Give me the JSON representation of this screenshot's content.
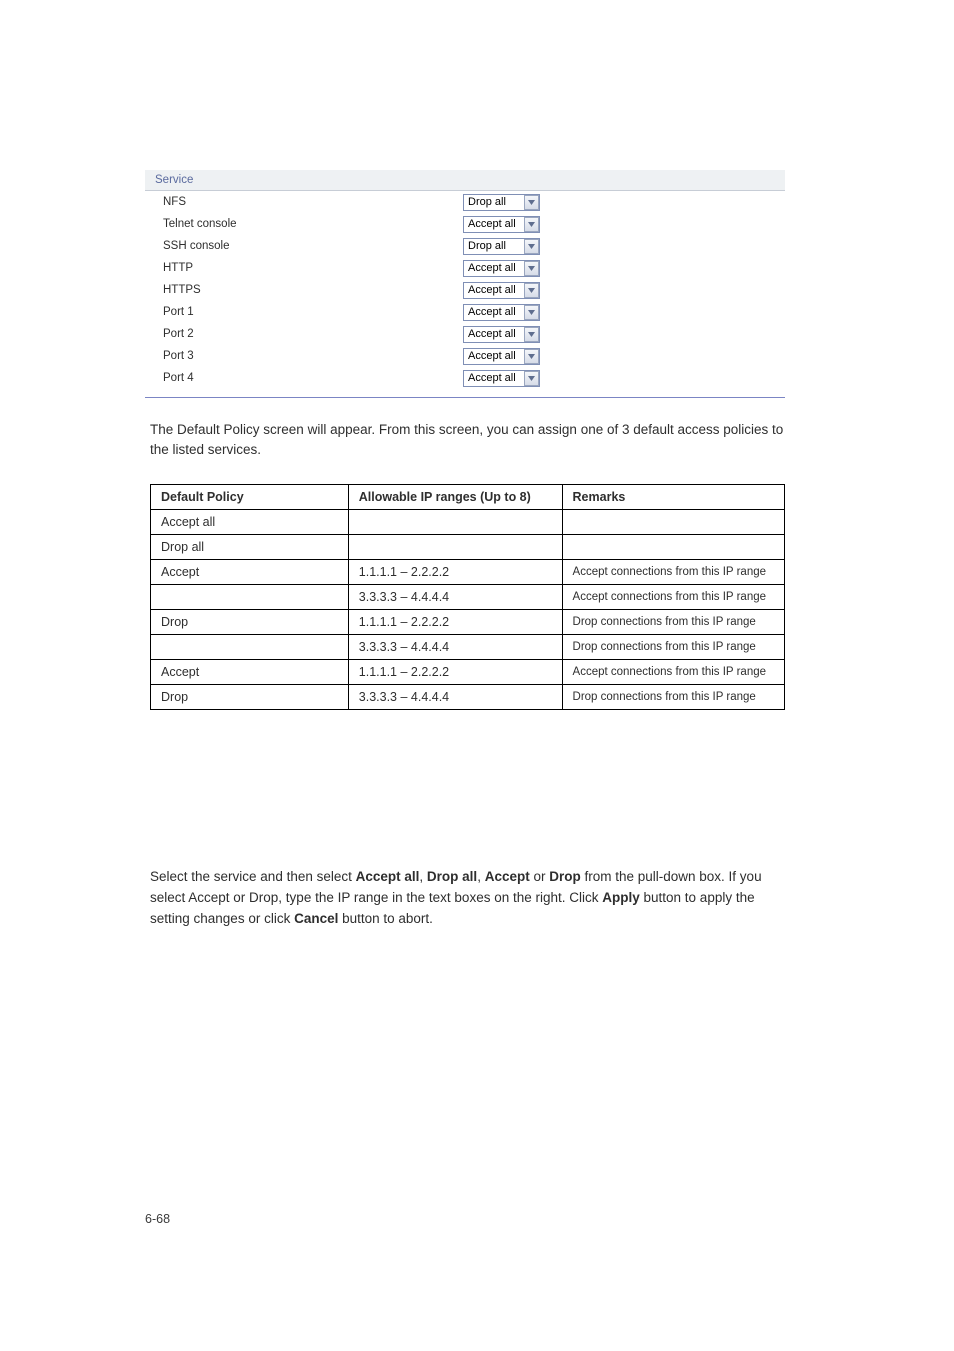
{
  "header_label": "Service",
  "services": [
    {
      "name": "NFS",
      "value": "Drop all"
    },
    {
      "name": "Telnet console",
      "value": "Accept all"
    },
    {
      "name": "SSH console",
      "value": "Drop all"
    },
    {
      "name": "HTTP",
      "value": "Accept all"
    },
    {
      "name": "HTTPS",
      "value": "Accept all"
    },
    {
      "name": "Port 1",
      "value": "Accept all"
    },
    {
      "name": "Port 2",
      "value": "Accept all"
    },
    {
      "name": "Port 3",
      "value": "Accept all"
    },
    {
      "name": "Port 4",
      "value": "Accept all"
    }
  ],
  "intro_para": "The Default Policy screen will appear. From this screen, you can assign one of 3 default access policies to the listed services.",
  "table": {
    "head": [
      "Default Policy",
      "Allowable IP ranges (Up to 8)",
      "Remarks"
    ],
    "rows": [
      [
        "Accept all",
        "",
        ""
      ],
      [
        "Drop all",
        "",
        ""
      ],
      [
        "Accept",
        "1.1.1.1 – 2.2.2.2",
        "Accept connections from this IP range"
      ],
      [
        "",
        "3.3.3.3 – 4.4.4.4",
        "Accept connections from this IP range"
      ],
      [
        "Drop",
        "1.1.1.1 – 2.2.2.2",
        "Drop connections from this IP range"
      ],
      [
        "",
        "3.3.3.3 – 4.4.4.4",
        "Drop connections from this IP range"
      ],
      [
        "Accept",
        "1.1.1.1 – 2.2.2.2",
        "Accept connections from this IP range"
      ],
      [
        "Drop",
        "3.3.3.3 – 4.4.4.4",
        "Drop connections from this IP range"
      ]
    ]
  },
  "footer_parts": {
    "a": "Select the service and then select ",
    "b1": "Accept all",
    "c": ", ",
    "b2": "Drop all",
    "d": ", ",
    "b3": "Accept",
    "e": " or ",
    "b4": "Drop",
    "f": " from the pull-down box. If you select Accept or Drop, type the IP range in the text boxes on the right. Click ",
    "b5": "Apply",
    "g": " button to apply the setting changes or click ",
    "b6": "Cancel",
    "h": " button to abort."
  },
  "page_number": "6-68"
}
